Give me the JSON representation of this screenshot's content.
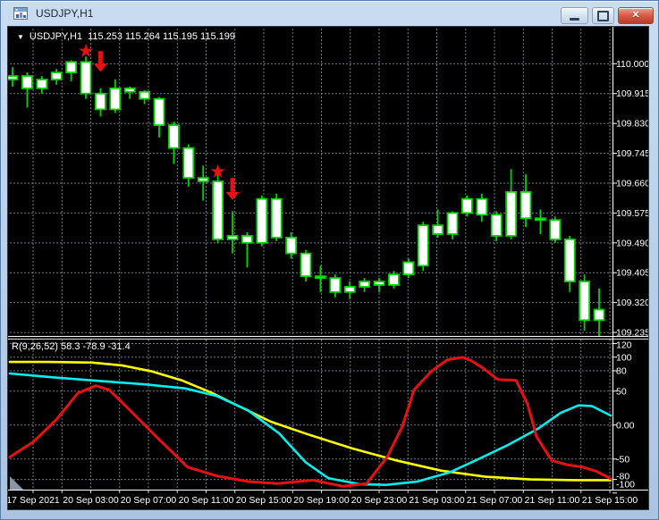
{
  "window": {
    "title": "USDJPY,H1",
    "controls": {
      "minimize": "minimize",
      "restore": "restore-down",
      "close": "close"
    }
  },
  "chart": {
    "header": {
      "dropdown_icon": "▼",
      "symbol_period": "USDJPY,H1",
      "ohlc_values": "115.253 115.264 115.195 115.199"
    },
    "price_axis_labels": [
      "110.000",
      "109.915",
      "109.830",
      "109.745",
      "109.660",
      "109.575",
      "109.490",
      "109.405",
      "109.320",
      "109.235"
    ],
    "time_axis_labels": [
      "17 Sep 2021",
      "20 Sep 03:00",
      "20 Sep 07:00",
      "20 Sep 11:00",
      "20 Sep 15:00",
      "20 Sep 19:00",
      "20 Sep 23:00",
      "21 Sep 03:00",
      "21 Sep 07:00",
      "21 Sep 11:00",
      "21 Sep 15:00"
    ]
  },
  "indicator": {
    "label": "R(9,26,52) 58.3 -78.9 -31.4",
    "axis_labels": [
      "120",
      "100",
      "80",
      "50",
      "0.00",
      "-50",
      "-80",
      "-100"
    ]
  },
  "colors": {
    "background": "#000000",
    "grid": "#6b7b8b",
    "candle_outline": "#00d400",
    "candle_fill": "#ffffff",
    "signal_red": "#e81010",
    "line_yellow": "#ffff00",
    "line_cyan": "#00f0f0",
    "line_red": "#e81010",
    "axis_text": "#ffffff",
    "separator": "#ffffff",
    "scroll_marker": "#8897a6"
  },
  "chart_data": [
    {
      "type": "candlestick",
      "title": "USDJPY,H1",
      "timeframe": "H1",
      "x_labels": [
        "17 Sep 2021",
        "20 Sep 03:00",
        "20 Sep 07:00",
        "20 Sep 11:00",
        "20 Sep 15:00",
        "20 Sep 19:00",
        "20 Sep 23:00",
        "21 Sep 03:00",
        "21 Sep 07:00",
        "21 Sep 11:00",
        "21 Sep 15:00"
      ],
      "ylim": [
        109.225,
        110.1
      ],
      "y_ticks": [
        110.0,
        109.915,
        109.83,
        109.745,
        109.66,
        109.575,
        109.49,
        109.405,
        109.32,
        109.235
      ],
      "candles": [
        [
          109.955,
          109.99,
          109.935,
          109.965
        ],
        [
          109.965,
          109.975,
          109.875,
          109.93
        ],
        [
          109.93,
          109.965,
          109.915,
          109.955
        ],
        [
          109.955,
          109.985,
          109.94,
          109.975
        ],
        [
          109.975,
          110.01,
          109.95,
          110.005
        ],
        [
          110.005,
          110.02,
          109.9,
          109.915
        ],
        [
          109.915,
          109.93,
          109.85,
          109.87
        ],
        [
          109.87,
          109.955,
          109.86,
          109.93
        ],
        [
          109.93,
          109.935,
          109.9,
          109.92
        ],
        [
          109.92,
          109.925,
          109.885,
          109.9
        ],
        [
          109.9,
          109.905,
          109.79,
          109.825
        ],
        [
          109.825,
          109.835,
          109.715,
          109.76
        ],
        [
          109.76,
          109.77,
          109.65,
          109.675
        ],
        [
          109.675,
          109.71,
          109.61,
          109.665
        ],
        [
          109.665,
          109.7,
          109.49,
          109.5
        ],
        [
          109.5,
          109.58,
          109.46,
          109.51
        ],
        [
          109.51,
          109.52,
          109.42,
          109.49
        ],
        [
          109.49,
          109.625,
          109.48,
          109.615
        ],
        [
          109.615,
          109.63,
          109.495,
          109.505
        ],
        [
          109.505,
          109.52,
          109.445,
          109.46
        ],
        [
          109.46,
          109.47,
          109.38,
          109.395
        ],
        [
          109.395,
          109.425,
          109.35,
          109.39
        ],
        [
          109.39,
          109.4,
          109.335,
          109.35
        ],
        [
          109.35,
          109.38,
          109.33,
          109.365
        ],
        [
          109.365,
          109.39,
          109.35,
          109.38
        ],
        [
          109.38,
          109.39,
          109.35,
          109.37
        ],
        [
          109.37,
          109.41,
          109.36,
          109.4
        ],
        [
          109.4,
          109.445,
          109.39,
          109.435
        ],
        [
          109.425,
          109.55,
          109.41,
          109.54
        ],
        [
          109.54,
          109.585,
          109.505,
          109.515
        ],
        [
          109.515,
          109.58,
          109.5,
          109.575
        ],
        [
          109.575,
          109.625,
          109.565,
          109.615
        ],
        [
          109.615,
          109.63,
          109.55,
          109.57
        ],
        [
          109.57,
          109.58,
          109.495,
          109.51
        ],
        [
          109.51,
          109.7,
          109.5,
          109.635
        ],
        [
          109.635,
          109.685,
          109.535,
          109.56
        ],
        [
          109.56,
          109.585,
          109.515,
          109.555
        ],
        [
          109.555,
          109.565,
          109.49,
          109.5
        ],
        [
          109.5,
          109.51,
          109.35,
          109.38
        ],
        [
          109.38,
          109.4,
          109.24,
          109.27
        ],
        [
          109.27,
          109.36,
          109.225,
          109.3
        ]
      ],
      "signals": [
        {
          "shape": "star",
          "candle": 5,
          "price": 110.036
        },
        {
          "shape": "arrow-down",
          "candle": 6,
          "price_top": 110.036,
          "price_bottom": 109.977
        },
        {
          "shape": "star",
          "candle": 14,
          "price": 109.693
        },
        {
          "shape": "arrow-down",
          "candle": 15,
          "price_top": 109.675,
          "price_bottom": 109.612
        }
      ]
    },
    {
      "type": "line",
      "title": "R(9,26,52)",
      "current_values": [
        58.3,
        -78.9,
        -31.4
      ],
      "ylim": [
        -95,
        126
      ],
      "y_ticks": [
        120,
        100,
        80,
        50,
        0,
        -50,
        -80,
        -100
      ],
      "x_unit": "px",
      "series": [
        {
          "name": "signal-yellow",
          "color_key": "line_yellow",
          "width": 2.6,
          "points": [
            [
              2,
              93
            ],
            [
              45,
              93
            ],
            [
              94,
              92
            ],
            [
              127,
              88
            ],
            [
              161,
              79
            ],
            [
              194,
              66
            ],
            [
              227,
              48
            ],
            [
              261,
              26
            ],
            [
              294,
              5
            ],
            [
              334,
              -13
            ],
            [
              384,
              -34
            ],
            [
              434,
              -52
            ],
            [
              484,
              -67
            ],
            [
              534,
              -76
            ],
            [
              584,
              -80
            ],
            [
              634,
              -81
            ],
            [
              674,
              -81
            ]
          ]
        },
        {
          "name": "signal-cyan",
          "color_key": "line_cyan",
          "width": 2.6,
          "points": [
            [
              2,
              76
            ],
            [
              53,
              70
            ],
            [
              103,
              65
            ],
            [
              153,
              60
            ],
            [
              198,
              54
            ],
            [
              233,
              43
            ],
            [
              268,
              22
            ],
            [
              303,
              -12
            ],
            [
              333,
              -55
            ],
            [
              358,
              -78
            ],
            [
              393,
              -87
            ],
            [
              423,
              -88
            ],
            [
              458,
              -83
            ],
            [
              493,
              -70
            ],
            [
              523,
              -52
            ],
            [
              558,
              -30
            ],
            [
              593,
              -5
            ],
            [
              618,
              18
            ],
            [
              638,
              29
            ],
            [
              653,
              28
            ],
            [
              674,
              14
            ]
          ]
        },
        {
          "name": "signal-red",
          "color_key": "line_red",
          "width": 3,
          "points": [
            [
              2,
              -47
            ],
            [
              28,
              -25
            ],
            [
              54,
              8
            ],
            [
              78,
              47
            ],
            [
              98,
              58
            ],
            [
              113,
              52
            ],
            [
              134,
              25
            ],
            [
              168,
              -20
            ],
            [
              201,
              -62
            ],
            [
              234,
              -75
            ],
            [
              268,
              -83
            ],
            [
              301,
              -86
            ],
            [
              341,
              -81
            ],
            [
              374,
              -90
            ],
            [
              401,
              -86
            ],
            [
              424,
              -47
            ],
            [
              441,
              -2
            ],
            [
              454,
              52
            ],
            [
              474,
              80
            ],
            [
              491,
              96
            ],
            [
              508,
              100
            ],
            [
              518,
              95
            ],
            [
              531,
              84
            ],
            [
              548,
              67
            ],
            [
              568,
              66
            ],
            [
              581,
              31
            ],
            [
              591,
              -17
            ],
            [
              608,
              -52
            ],
            [
              624,
              -58
            ],
            [
              643,
              -62
            ],
            [
              658,
              -68
            ],
            [
              674,
              -79
            ]
          ]
        }
      ]
    }
  ]
}
